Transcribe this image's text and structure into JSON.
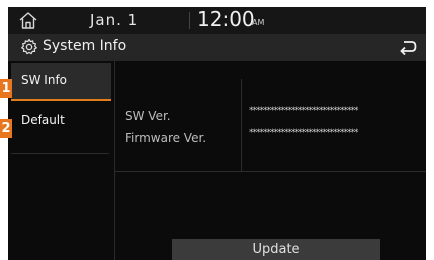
{
  "status": {
    "date": "Jan.  1",
    "time": "12:00",
    "ampm": "AM"
  },
  "titlebar": {
    "title": "System Info"
  },
  "menu": {
    "items": [
      {
        "label": "SW Info",
        "marker": "1"
      },
      {
        "label": "Default",
        "marker": "2"
      }
    ]
  },
  "content": {
    "sw_ver_label": "SW Ver.",
    "sw_ver_value": "*******************************",
    "fw_ver_label": "Firmware Ver.",
    "fw_ver_value": "*******************************",
    "update_label": "Update"
  },
  "colors": {
    "accent": "#e17e1c",
    "background": "#0b0b0b",
    "titlebar": "#262626"
  },
  "icons": [
    "home-icon",
    "gear-icon",
    "back-icon"
  ]
}
